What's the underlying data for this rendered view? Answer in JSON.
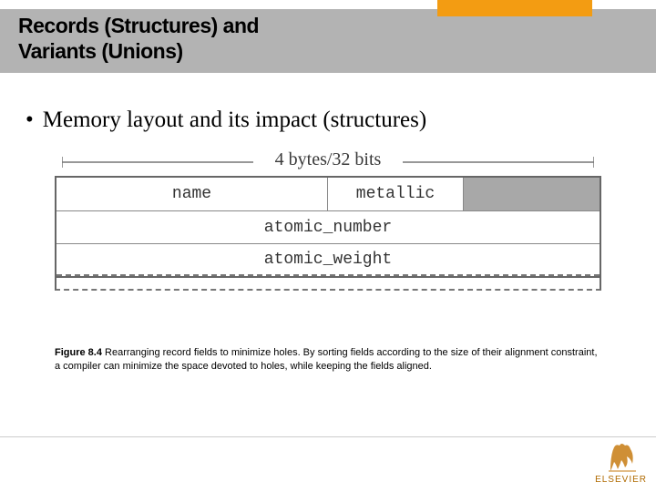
{
  "title_line1": "Records (Structures) and",
  "title_line2": "Variants (Unions)",
  "bullet_text": "Memory layout and its impact (structures)",
  "figure": {
    "width_label": "4 bytes/32 bits",
    "row1_field1": "name",
    "row1_field2": "metallic",
    "row2_field": "atomic_number",
    "row3_field": "atomic_weight"
  },
  "caption": {
    "label": "Figure 8.4",
    "text": "Rearranging record fields to minimize holes. By sorting fields according to the size of their alignment constraint, a compiler can minimize the space devoted to holes, while keeping the fields aligned."
  },
  "publisher": "ELSEVIER"
}
